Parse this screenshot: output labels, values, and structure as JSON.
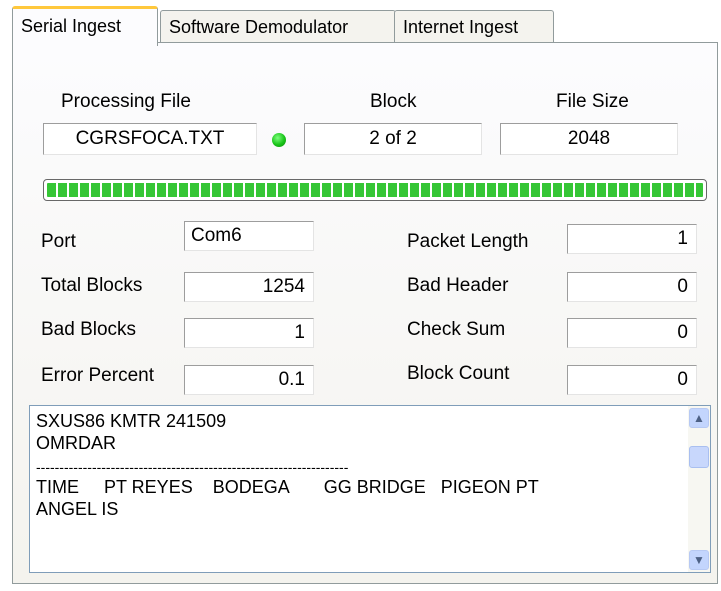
{
  "tabs": [
    {
      "label": "Serial Ingest",
      "active": true
    },
    {
      "label": "Software Demodulator",
      "active": false
    },
    {
      "label": "Internet Ingest",
      "active": false
    }
  ],
  "header": {
    "processing_file_label": "Processing File",
    "processing_file_value": "CGRSFOCA.TXT",
    "block_label": "Block",
    "block_value": "2 of 2",
    "file_size_label": "File Size",
    "file_size_value": "2048"
  },
  "status_led_color": "#19c419",
  "progress": {
    "fraction": 1.0,
    "color": "#35c635"
  },
  "stats_left": {
    "port_label": "Port",
    "port_value": "Com6",
    "total_blocks_label": "Total Blocks",
    "total_blocks_value": "1254",
    "bad_blocks_label": "Bad Blocks",
    "bad_blocks_value": "1",
    "error_percent_label": "Error Percent",
    "error_percent_value": "0.1"
  },
  "stats_right": {
    "packet_length_label": "Packet Length",
    "packet_length_value": "1",
    "bad_header_label": "Bad Header",
    "bad_header_value": "0",
    "check_sum_label": "Check Sum",
    "check_sum_value": "0",
    "block_count_label": "Block Count",
    "block_count_value": "0"
  },
  "memo": {
    "lines": [
      "SXUS86 KMTR 241509",
      "OMRDAR",
      "-------------------------------------------------------------------",
      "TIME     PT REYES    BODEGA       GG BRIDGE   PIGEON PT",
      "ANGEL IS"
    ]
  }
}
